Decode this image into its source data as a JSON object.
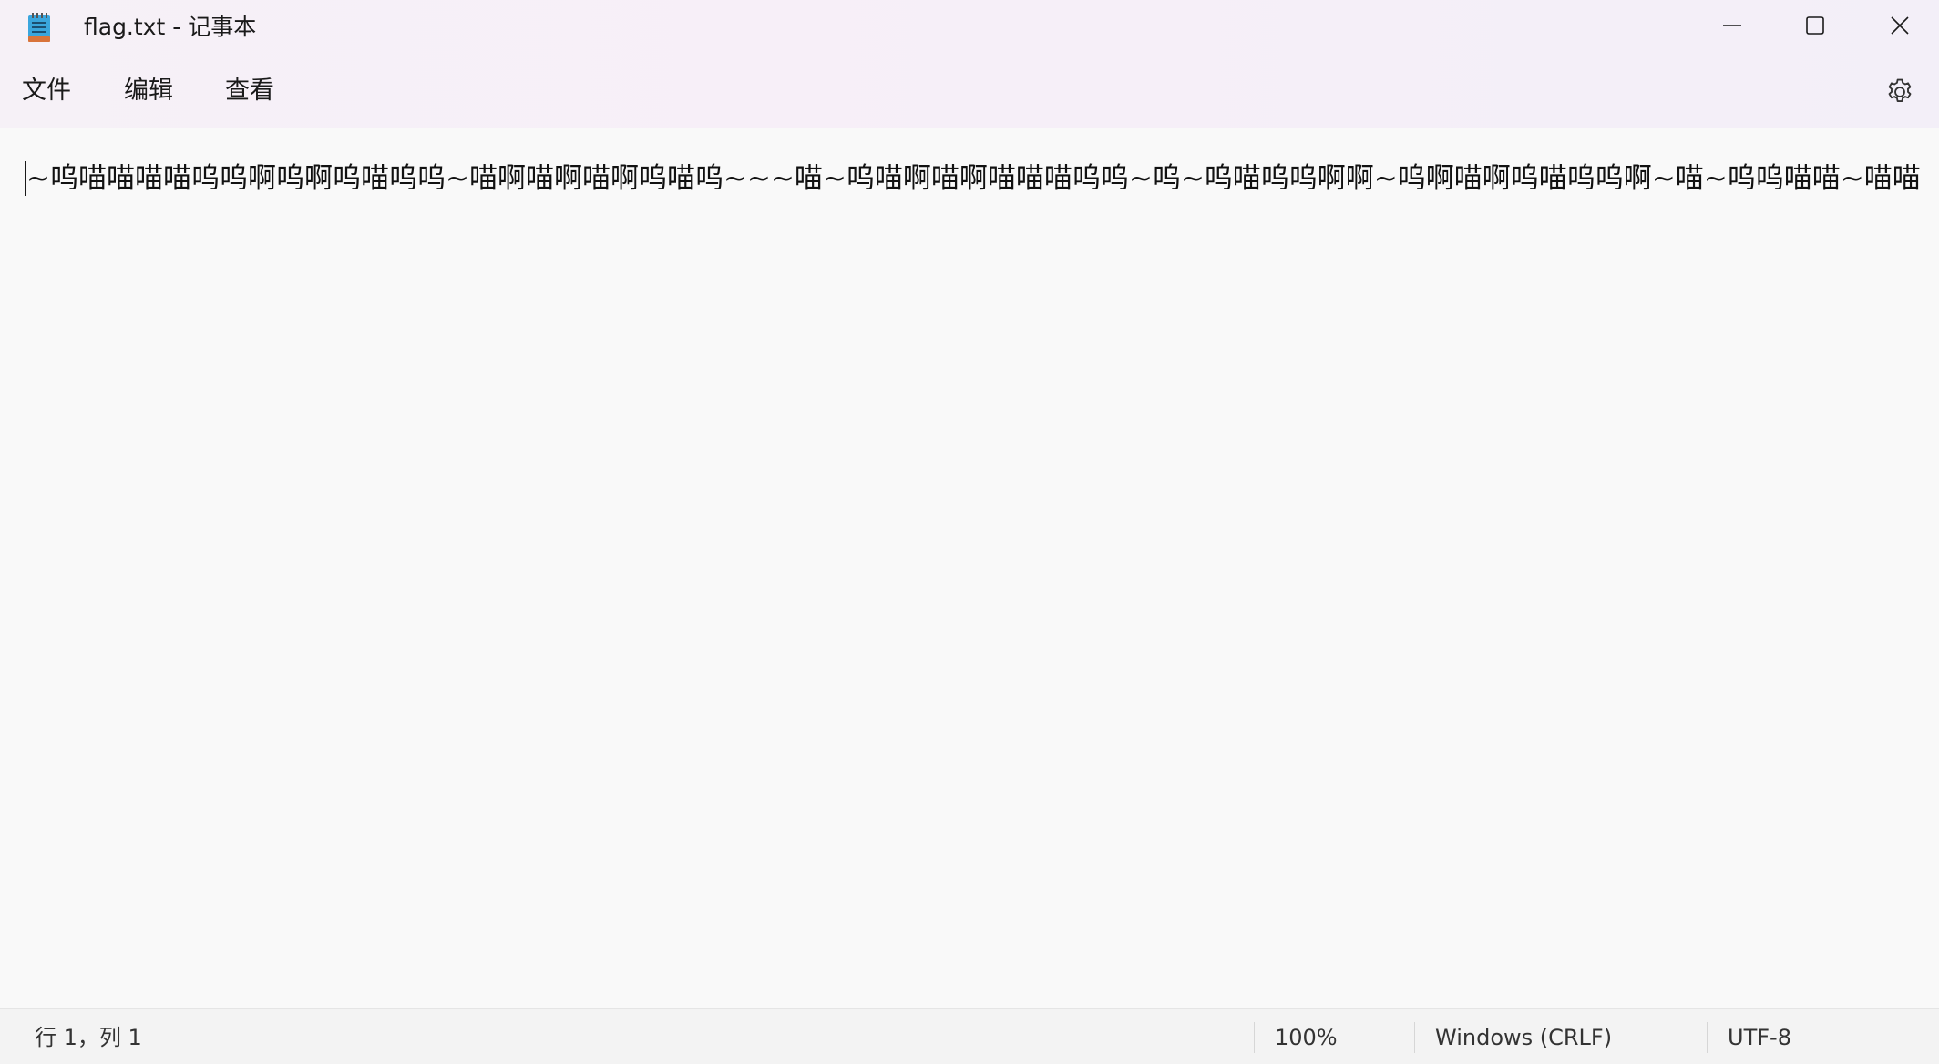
{
  "window": {
    "title": "flag.txt - 记事本",
    "minimize_icon": "minimize-icon",
    "maximize_icon": "maximize-icon",
    "close_icon": "close-icon"
  },
  "menu": {
    "file": "文件",
    "edit": "编辑",
    "view": "查看",
    "settings_icon": "gear-icon"
  },
  "editor": {
    "content": "~呜喵喵喵喵呜呜啊呜啊呜喵呜呜~喵啊喵啊喵啊呜喵呜~~~喵~呜喵啊喵啊喵喵喵呜呜~呜~呜喵呜呜啊啊~呜啊喵啊呜喵呜呜啊~喵~呜呜喵喵~喵喵"
  },
  "status": {
    "position": "行 1，列 1",
    "zoom": "100%",
    "line_ending": "Windows (CRLF)",
    "encoding": "UTF-8"
  },
  "colors": {
    "titlebar_bg": "#f6f1f7",
    "editor_bg": "#f9f9f9",
    "status_bg": "#f3f3f3",
    "app_icon_blue": "#3aa6dd"
  }
}
